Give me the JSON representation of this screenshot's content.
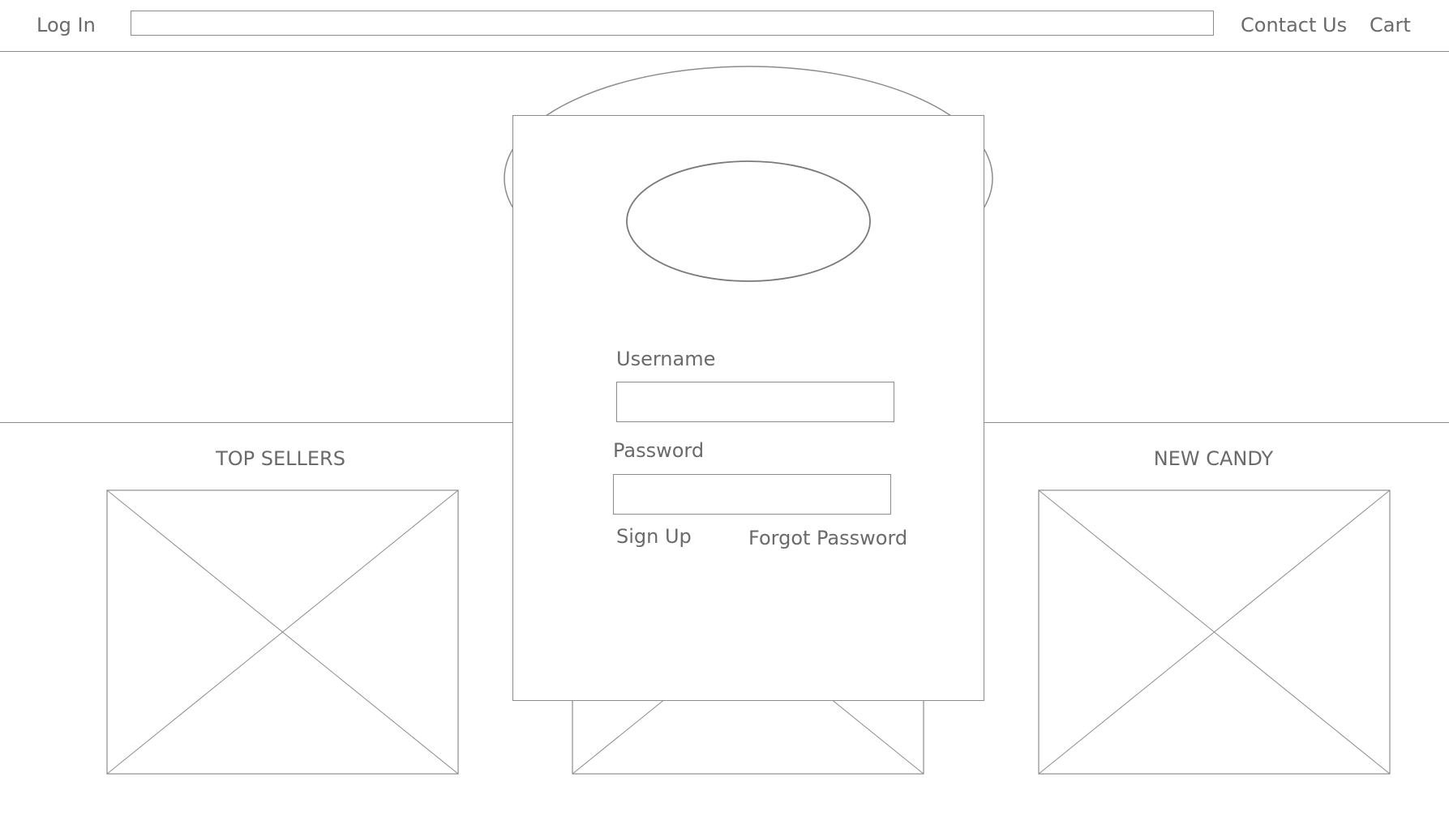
{
  "header": {
    "login_label": "Log In",
    "contact_label": "Contact Us",
    "cart_label": "Cart",
    "search_value": ""
  },
  "sections": {
    "left_title": "TOP SELLERS",
    "right_title": "NEW CANDY"
  },
  "login_modal": {
    "username_label": "Username",
    "username_value": "",
    "password_label": "Password",
    "password_value": "",
    "signup_label": "Sign Up",
    "forgot_label": "Forgot Password"
  },
  "icons": {
    "logo": "logo-placeholder",
    "modal_logo": "modal-logo-placeholder",
    "image_placeholder": "image-placeholder-icon"
  },
  "colors": {
    "line": "#8c8c8c",
    "text": "#6a6a6a",
    "background": "#ffffff"
  }
}
